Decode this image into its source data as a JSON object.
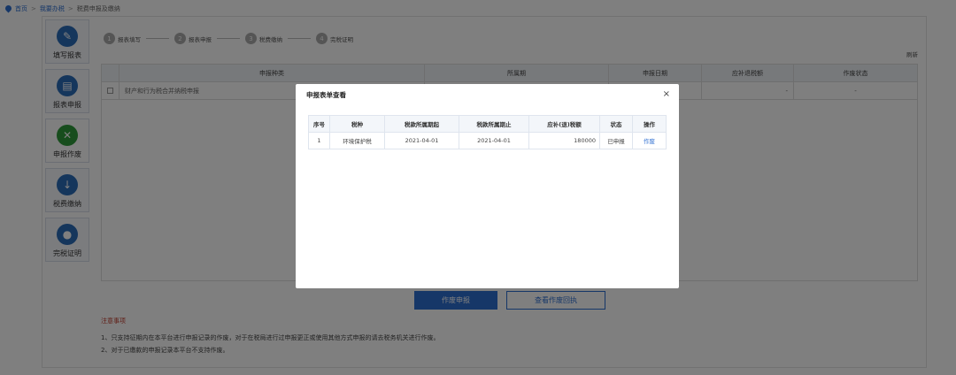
{
  "breadcrumb": {
    "home": "首页",
    "sep1": ">",
    "section": "我要办税",
    "sep2": ">",
    "current": "税费申报及缴纳"
  },
  "nav": [
    {
      "label": "填写报表",
      "icon": "edit-icon"
    },
    {
      "label": "报表申报",
      "icon": "submit-report-icon"
    },
    {
      "label": "申报作废",
      "icon": "void-declaration-icon"
    },
    {
      "label": "税费缴纳",
      "icon": "payment-icon"
    },
    {
      "label": "完税证明",
      "icon": "certificate-icon"
    }
  ],
  "steps": [
    {
      "num": "1",
      "label": "报表填写"
    },
    {
      "num": "2",
      "label": "报表申报"
    },
    {
      "num": "3",
      "label": "税费缴纳"
    },
    {
      "num": "4",
      "label": "完税证明"
    }
  ],
  "refresh_label": "刷新",
  "bg_table": {
    "headers": [
      "申报种类",
      "所属期",
      "申报日期",
      "应补退税额",
      "作废状态"
    ],
    "rows": [
      {
        "kind": "财产和行为税合并纳税申报",
        "period": "",
        "date": "",
        "amount": "-",
        "status": "-"
      }
    ]
  },
  "buttons": {
    "void_declare": "作废申报",
    "view_receipt": "查看作废回执"
  },
  "notes": {
    "title": "注意事项",
    "line1": "1、只支持征期内在本平台进行申报记录的作废，对于在税局进行过申报更正或使用其他方式申报的请去税务机关进行作废。",
    "line2": "2、对于已缴款的申报记录本平台不支持作废。"
  },
  "modal": {
    "title": "申报表单查看",
    "close": "×",
    "headers": [
      "序号",
      "税种",
      "税款所属期起",
      "税款所属期止",
      "应补(退)税额",
      "状态",
      "操作"
    ],
    "rows": [
      {
        "index": "1",
        "tax": "环境保护税",
        "start": "2021-04-01",
        "end": "2021-04-01",
        "amount": "180000",
        "status": "已申报",
        "action": "作废"
      }
    ]
  },
  "colors": {
    "accent": "#2d6ed1",
    "active_nav": "#2f9a3a",
    "notes_title": "#c0392b"
  }
}
